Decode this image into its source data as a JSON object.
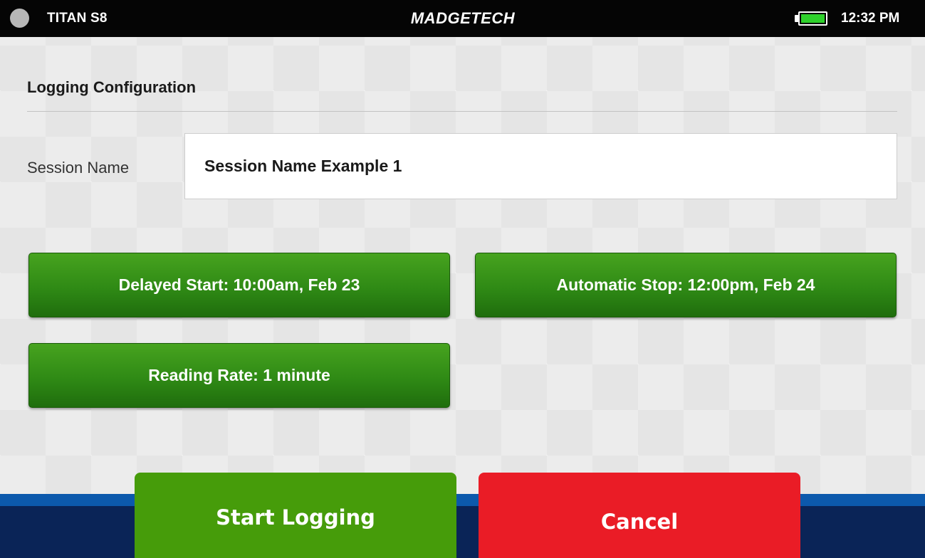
{
  "status_bar": {
    "device_name": "TITAN S8",
    "brand": "MADGETECH",
    "time": "12:32 PM",
    "battery_level": 1.0,
    "battery_color": "#2ed12b"
  },
  "config": {
    "title": "Logging Configuration",
    "session_label": "Session Name",
    "session_value": "Session Name Example 1",
    "delayed_start": "Delayed Start: 10:00am, Feb 23",
    "automatic_stop": "Automatic Stop: 12:00pm, Feb 24",
    "reading_rate": "Reading Rate: 1 minute"
  },
  "actions": {
    "start_label": "Start Logging",
    "cancel_label": "Cancel"
  },
  "colors": {
    "option_button": "#2f8a15",
    "start_button": "#469c0a",
    "cancel_button": "#ea1c26",
    "bottom_bar": "#0a2457",
    "bottom_accent": "#0c59ac"
  },
  "icons": {
    "status": "status-dot-icon",
    "battery": "battery-icon"
  }
}
